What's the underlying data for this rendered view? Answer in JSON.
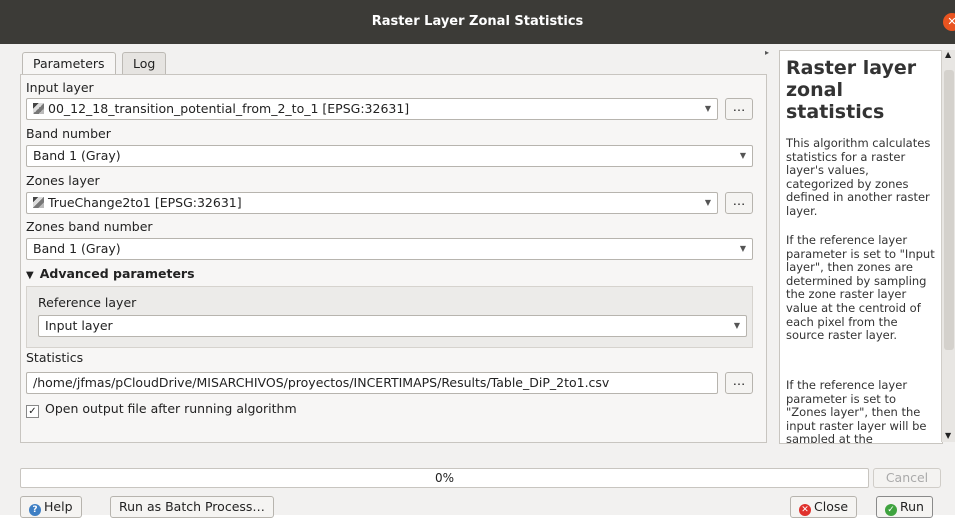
{
  "window": {
    "title": "Raster Layer Zonal Statistics"
  },
  "tabs": [
    {
      "label": "Parameters",
      "active": true
    },
    {
      "label": "Log",
      "active": false
    }
  ],
  "params": {
    "input_layer_label": "Input layer",
    "input_layer_value": "00_12_18_transition_potential_from_2_to_1 [EPSG:32631]",
    "band_number_label": "Band number",
    "band_number_value": "Band 1 (Gray)",
    "zones_layer_label": "Zones layer",
    "zones_layer_value": "TrueChange2to1 [EPSG:32631]",
    "zones_band_label": "Zones band number",
    "zones_band_value": "Band 1 (Gray)",
    "advanced_label": "Advanced parameters",
    "reference_layer_label": "Reference layer",
    "reference_layer_value": "Input layer",
    "statistics_label": "Statistics",
    "statistics_path": "/home/jfmas/pCloudDrive/MISARCHIVOS/proyectos/INCERTIMAPS/Results/Table_DiP_2to1.csv",
    "open_output_label": "Open output file after running algorithm",
    "open_output_checked": true,
    "browse_label": "…"
  },
  "help": {
    "title": "Raster layer zonal statistics",
    "p1": "This algorithm calculates statistics for a raster layer's values, categorized by zones defined in another raster layer.",
    "p2": "If the reference layer parameter is set to \"Input layer\", then zones are determined by sampling the zone raster layer value at the centroid of each pixel from the source raster layer.",
    "p3": "If the reference layer parameter is set to \"Zones layer\", then the input raster layer will be sampled at the"
  },
  "progress": {
    "value": 0,
    "label": "0%"
  },
  "buttons": {
    "cancel": "Cancel",
    "help": "Help",
    "batch": "Run as Batch Process…",
    "close": "Close",
    "run": "Run"
  },
  "colors": {
    "titlebar": "#3c3b37",
    "accent": "#e95420",
    "help_icon": "#3e7fc4",
    "close_icon": "#e0312c",
    "run_icon": "#3fa33f"
  }
}
